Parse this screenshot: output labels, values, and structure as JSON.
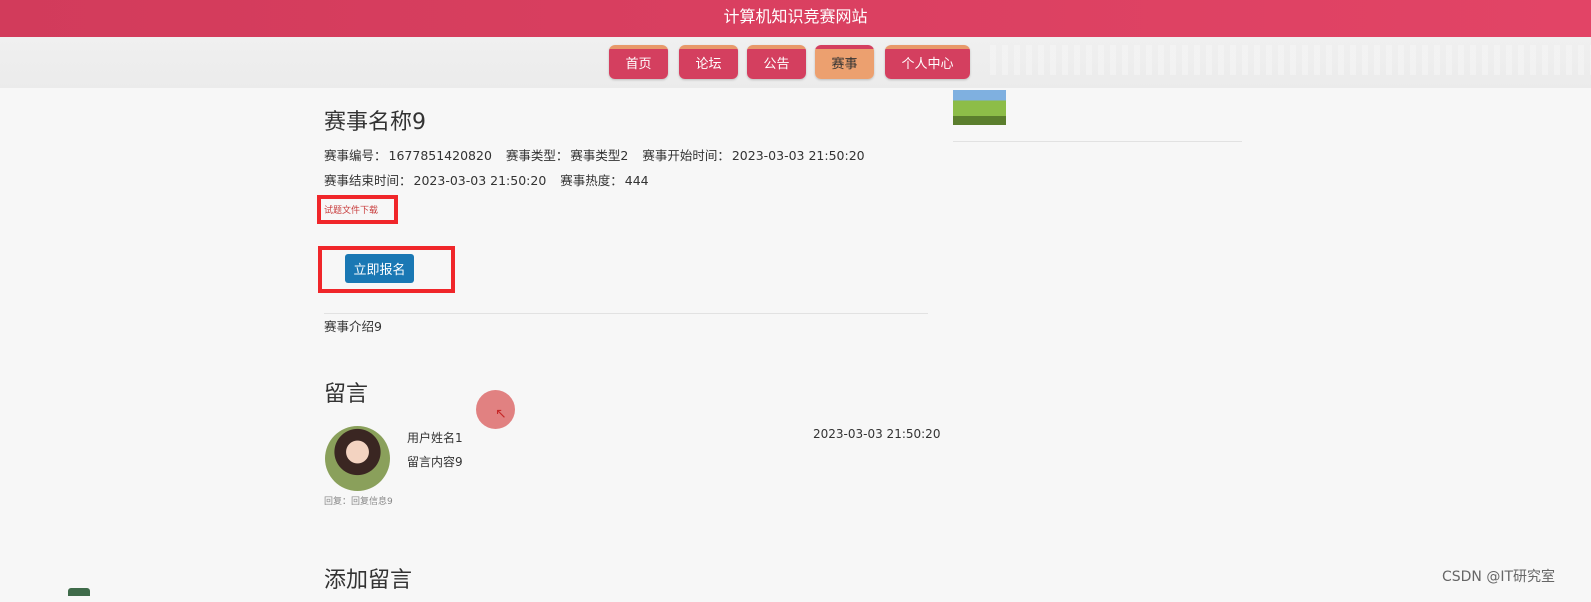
{
  "header": {
    "title": "计算机知识竞赛网站"
  },
  "nav": {
    "items": [
      {
        "label": "首页"
      },
      {
        "label": "论坛"
      },
      {
        "label": "公告"
      },
      {
        "label": "赛事",
        "active": true
      },
      {
        "label": "个人中心"
      }
    ]
  },
  "event": {
    "name": "赛事名称9",
    "number_label": "赛事编号：",
    "number": "1677851420820",
    "type_label": "赛事类型：",
    "type": "赛事类型2",
    "start_label": "赛事开始时间：",
    "start": "2023-03-03 21:50:20",
    "end_label": "赛事结束时间：",
    "end": "2023-03-03 21:50:20",
    "heat_label": "赛事热度：",
    "heat": "444",
    "download_label": "试题文件下载",
    "signup_label": "立即报名",
    "intro": "赛事介绍9"
  },
  "comments": {
    "heading": "留言",
    "items": [
      {
        "user": "用户姓名1",
        "content": "留言内容9",
        "time": "2023-03-03 21:50:20",
        "reply": "回复：回复信息9"
      }
    ]
  },
  "add_comment": {
    "heading": "添加留言"
  },
  "watermark": "CSDN @IT研究室",
  "colors": {
    "header": "#e24466",
    "nav_button": "#d43f5f",
    "nav_active": "#eca06f",
    "signup": "#1a78b4",
    "highlight_box": "#f0262a"
  }
}
